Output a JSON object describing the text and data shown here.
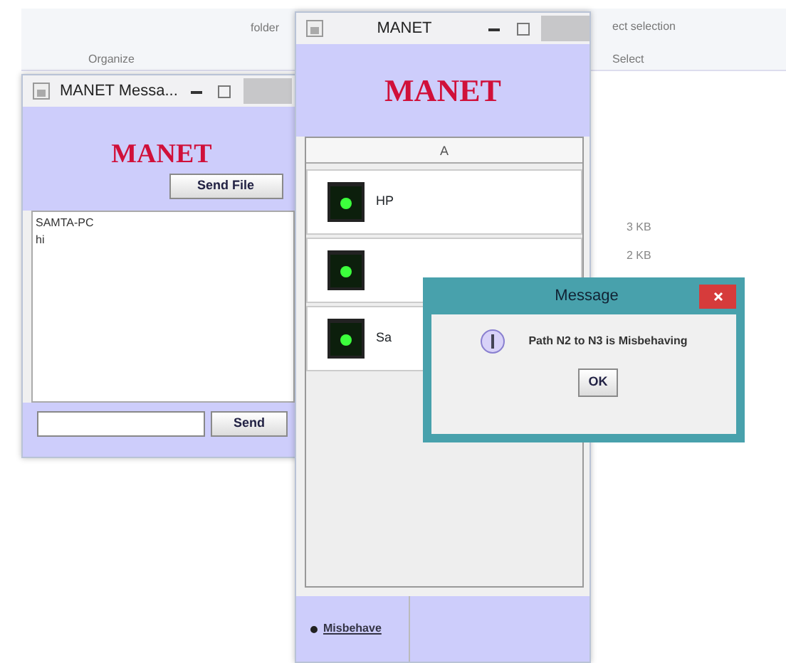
{
  "explorer": {
    "ribbon_labels": [
      "folder",
      "ect selection",
      "Organize",
      "Select"
    ],
    "sizes": [
      "3 KB",
      "2 KB"
    ]
  },
  "chat_window": {
    "title": "MANET Messa...",
    "heading": "MANET",
    "send_file_button": "Send File",
    "messages": [
      "SAMTA-PC",
      "hi"
    ],
    "send_button": "Send"
  },
  "node_window": {
    "title": "MANET",
    "heading": "MANET",
    "table": {
      "columns": [
        "A"
      ],
      "rows": [
        {
          "label": "HP"
        },
        {},
        {
          "label": "Sa"
        }
      ]
    },
    "radio": {
      "label": "Misbehave",
      "selected": true
    }
  },
  "dialog": {
    "title": "Message",
    "message": "Path N2 to N3 is Misbehaving",
    "ok_button": "OK"
  }
}
